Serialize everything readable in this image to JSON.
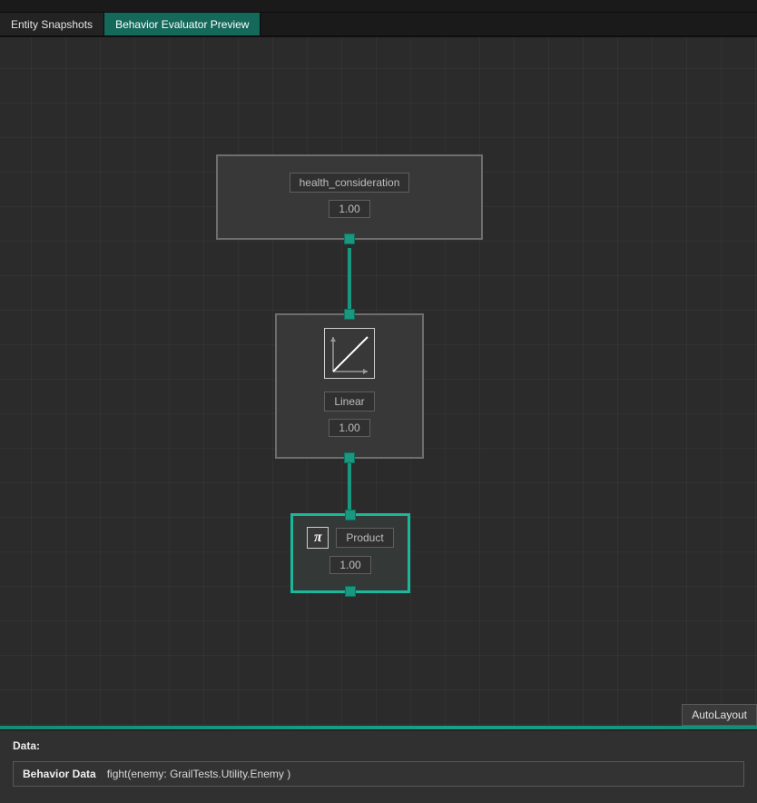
{
  "tabs": {
    "snapshots": "Entity Snapshots",
    "evaluator": "Behavior Evaluator Preview"
  },
  "nodes": {
    "consideration": {
      "title": "health_consideration",
      "value": "1.00"
    },
    "curve": {
      "title": "Linear",
      "value": "1.00"
    },
    "aggregator": {
      "title": "Product",
      "value": "1.00",
      "icon_label": "π"
    }
  },
  "controls": {
    "autolayout": "AutoLayout"
  },
  "footer": {
    "section": "Data:",
    "behavior_key": "Behavior Data",
    "behavior_value": "fight(enemy: GrailTests.Utility.Enemy )"
  },
  "colors": {
    "accent": "#19b89b"
  }
}
